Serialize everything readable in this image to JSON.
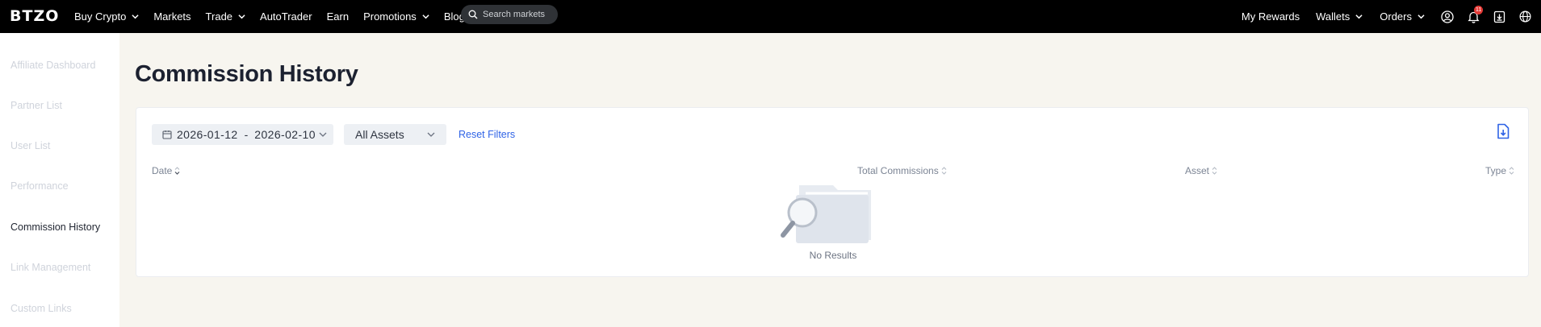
{
  "header": {
    "logo": "BTZO",
    "nav": [
      {
        "label": "Buy Crypto",
        "dropdown": true
      },
      {
        "label": "Markets",
        "dropdown": false
      },
      {
        "label": "Trade",
        "dropdown": true
      },
      {
        "label": "AutoTrader",
        "dropdown": false
      },
      {
        "label": "Earn",
        "dropdown": false
      },
      {
        "label": "Promotions",
        "dropdown": true
      },
      {
        "label": "Blog",
        "dropdown": false
      }
    ],
    "search_placeholder": "Search markets",
    "right": {
      "rewards": "My Rewards",
      "wallets": "Wallets",
      "orders": "Orders",
      "notification_count": "11"
    },
    "icons": [
      "user-icon",
      "bell-icon",
      "download-app-icon",
      "globe-icon"
    ]
  },
  "sidebar": {
    "items": [
      {
        "label": "Affiliate Dashboard",
        "active": false
      },
      {
        "label": "Partner List",
        "active": false
      },
      {
        "label": "User List",
        "active": false
      },
      {
        "label": "Performance",
        "active": false
      },
      {
        "label": "Commission History",
        "active": true
      },
      {
        "label": "Link Management",
        "active": false
      },
      {
        "label": "Custom Links",
        "active": false
      }
    ]
  },
  "main": {
    "title": "Commission History",
    "filters": {
      "date_from": "2026-01-12",
      "date_to": "2026-02-10",
      "date_separator": "-",
      "asset": "All Assets",
      "reset": "Reset Filters"
    },
    "table": {
      "columns": [
        "Date",
        "Total Commissions",
        "Asset",
        "Type"
      ],
      "rows": [],
      "empty_text": "No Results"
    }
  },
  "colors": {
    "topbar": "#000000",
    "accent": "#2f63e6",
    "badge": "#e53935",
    "background": "#f7f5ef"
  }
}
